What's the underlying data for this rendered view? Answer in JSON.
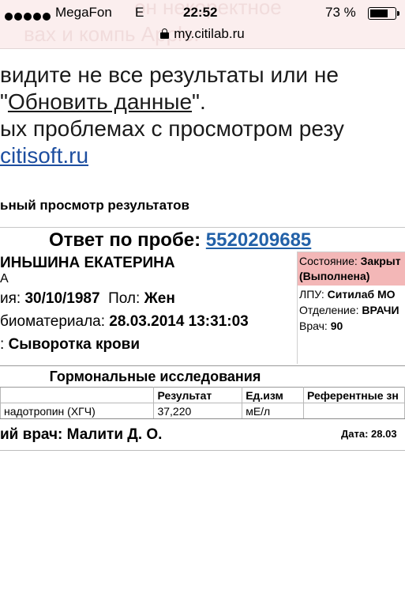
{
  "status_bar": {
    "carrier": "MegaFon",
    "network": "E",
    "time": "22:52",
    "battery_percent": "73 %",
    "battery_level": 0.73
  },
  "browser": {
    "url": "my.citilab.ru",
    "background_ghost_1": "он некоректное",
    "background_ghost_2": "вах и компь     Apple."
  },
  "notice": {
    "line1": "видите не все результаты или не",
    "line2_pre": "\"",
    "line2_link": "Обновить данные",
    "line2_post": "\".",
    "line3": "ых проблемах с просмотром резу",
    "line4_link": "citisoft.ru"
  },
  "page_heading": "ьный просмотр результатов",
  "report": {
    "answer_label": "Ответ по пробе:",
    "answer_number": "5520209685",
    "patient_name": "ИНЬШИНА ЕКАТЕРИНА",
    "patient_name_cont": "А",
    "birth_label": "ия:",
    "birth_value": "30/10/1987",
    "sex_label": "Пол:",
    "sex_value": "Жен",
    "biomaterial_date_label": "биоматериала:",
    "biomaterial_date_value": "28.03.2014 13:31:03",
    "material_label": ":",
    "material_value": "Сыворотка крови",
    "state_label": "Состояние:",
    "state_value": "Закрыт",
    "state_sub": "(Выполнена)",
    "lpu_label": "ЛПУ:",
    "lpu_value": "Ситилаб МО",
    "department_label": "Отделение:",
    "department_value": "ВРАЧИ",
    "doctor_label": "Врач:",
    "doctor_value": "90",
    "section_title": "Гормональные исследования",
    "columns": [
      "",
      "Результат",
      "Ед.изм",
      "Референтные зн"
    ],
    "rows": [
      [
        "надотропин (ХГЧ)",
        "37,220",
        "мЕ/л",
        ""
      ]
    ],
    "physician_line": "ий врач: Малити Д. О.",
    "date_label": "Дата: 28.03"
  },
  "colors": {
    "link": "#2261a8",
    "state_background": "#f3b7b7",
    "top_background": "#fbeeee"
  }
}
